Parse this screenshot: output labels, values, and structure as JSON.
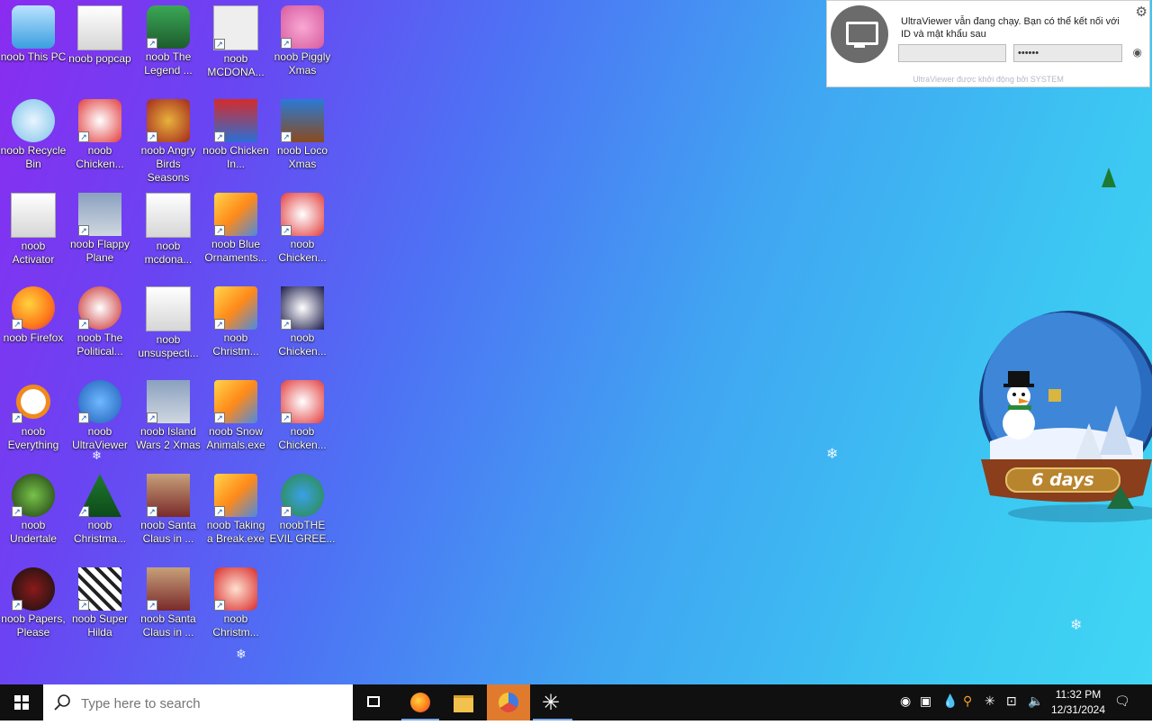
{
  "desktop_icons": [
    {
      "label": "noob This PC",
      "icon": "computer-icon",
      "shortcut": false
    },
    {
      "label": "noob popcap",
      "icon": "folder-icon",
      "shortcut": false
    },
    {
      "label": "noob The Legend ...",
      "icon": "game-hero-icon",
      "shortcut": true
    },
    {
      "label": "noob MCDONA...",
      "icon": "binary-file-icon",
      "shortcut": true
    },
    {
      "label": "noob Piggly Xmas",
      "icon": "pig-icon",
      "shortcut": true
    },
    {
      "label": "noob Recycle Bin",
      "icon": "recycle-bin-icon",
      "shortcut": false
    },
    {
      "label": "noob Chicken...",
      "icon": "chicken-icon",
      "shortcut": true
    },
    {
      "label": "noob Angry Birds Seasons",
      "icon": "angry-birds-icon",
      "shortcut": true
    },
    {
      "label": "noob Chicken In...",
      "icon": "snowman-icon",
      "shortcut": true
    },
    {
      "label": "noob Loco Xmas",
      "icon": "bear-icon",
      "shortcut": true
    },
    {
      "label": "noob Activator",
      "icon": "folder-icon",
      "shortcut": false
    },
    {
      "label": "noob Flappy Plane",
      "icon": "photo-icon",
      "shortcut": true
    },
    {
      "label": "noob mcdona...",
      "icon": "folder-icon",
      "shortcut": false
    },
    {
      "label": "noob Blue Ornaments...",
      "icon": "installer-icon",
      "shortcut": true
    },
    {
      "label": "noob Chicken...",
      "icon": "chicken-icon",
      "shortcut": true
    },
    {
      "label": "noob Firefox",
      "icon": "firefox-icon",
      "shortcut": true
    },
    {
      "label": "noob The Political...",
      "icon": "badge-2020-icon",
      "shortcut": true
    },
    {
      "label": "noob unsuspecti...",
      "icon": "folder-icon",
      "shortcut": false
    },
    {
      "label": "noob Christm...",
      "icon": "installer-icon",
      "shortcut": true
    },
    {
      "label": "noob Chicken...",
      "icon": "balls-icon",
      "shortcut": true
    },
    {
      "label": "noob Everything",
      "icon": "magnifier-icon",
      "shortcut": true
    },
    {
      "label": "noob UltraViewer",
      "icon": "ultraviewer-icon",
      "shortcut": true
    },
    {
      "label": "noob Island Wars 2 Xmas",
      "icon": "photo-icon",
      "shortcut": true
    },
    {
      "label": "noob Snow Animals.exe",
      "icon": "installer-icon",
      "shortcut": true
    },
    {
      "label": "noob Chicken...",
      "icon": "chicken-icon",
      "shortcut": true
    },
    {
      "label": "noob Undertale",
      "icon": "undertale-icon",
      "shortcut": true
    },
    {
      "label": "noob Christma...",
      "icon": "tree-99-icon",
      "shortcut": true
    },
    {
      "label": "noob Santa Claus in ...",
      "icon": "santa-icon",
      "shortcut": true
    },
    {
      "label": "noob Taking a Break.exe",
      "icon": "installer-icon",
      "shortcut": true
    },
    {
      "label": "noobTHE EVIL GREE...",
      "icon": "people-icon",
      "shortcut": true
    },
    {
      "label": "noob Papers, Please",
      "icon": "papers-please-icon",
      "shortcut": true
    },
    {
      "label": "noob Super Hilda",
      "icon": "pixel-icon",
      "shortcut": true
    },
    {
      "label": "noob Santa Claus in ...",
      "icon": "santa-icon",
      "shortcut": true
    },
    {
      "label": "noob Christm...",
      "icon": "santa-face-icon",
      "shortcut": true
    }
  ],
  "ultraviewer_panel": {
    "message": "UltraViewer vẫn đang chạy. Bạn có thể kết nối với ID và mật khẩu sau",
    "id_value": "",
    "password_value": "••••••",
    "footer": "UltraViewer được khởi động bởi SYSTEM"
  },
  "widget": {
    "countdown": "6 days"
  },
  "taskbar": {
    "search_placeholder": "Type here to search",
    "apps": [
      "task-view-icon",
      "firefox-icon",
      "file-explorer-icon",
      "chrome-like-icon",
      "snowflake-app-icon"
    ],
    "clock_time": "11:32 PM",
    "clock_date": "12/31/2024"
  },
  "colors": {
    "bg_start": "#8a2cf0",
    "bg_end": "#40d6f4",
    "taskbar": "#101010",
    "active_app": "#e07b2e"
  }
}
